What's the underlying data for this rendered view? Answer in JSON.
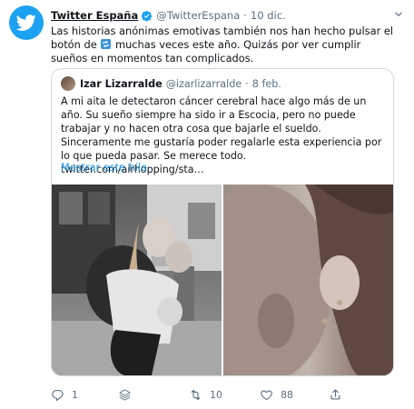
{
  "tweet": {
    "author_name": "Twitter España",
    "author_handle": "@TwitterEspana",
    "separator": "·",
    "date": "10 dic.",
    "text_before_icon": "Las historias anónimas emotivas también nos han hecho pulsar el botón de",
    "text_after_icon": "muchas veces este año. Quizás por ver cumplir sueños en momentos tan complicados."
  },
  "quoted_tweet": {
    "author_name": "Izar Lizarralde",
    "author_handle": "@izarlizarralde",
    "separator": "·",
    "date": "8 feb.",
    "text": "A mi aita le detectaron cáncer cerebral hace algo más de un año. Su sueño siempre ha sido ir a Escocia, pero no puede trabajar y no hacen otra cosa que bajarle el sueldo. Sinceramente me gustaría poder regalarle esta experiencia por lo que pueda pasar. Se merece todo. twitter.com/airhopping/sta…",
    "show_thread_label": "Mostrar este hilo"
  },
  "actions": {
    "reply_count": "1",
    "retweet_count": "10",
    "like_count": "88"
  },
  "icons": {
    "logo": "twitter-bird-icon",
    "verified": "verified-badge-icon",
    "menu": "chevron-down-icon",
    "inline": "retweet-emoji-icon",
    "reply": "reply-icon",
    "layers": "layers-icon",
    "retweet": "retweet-icon",
    "like": "heart-icon",
    "share": "share-icon"
  },
  "colors": {
    "brand": "#1da1f2",
    "link": "#1b95e0",
    "muted": "#5b7083"
  }
}
